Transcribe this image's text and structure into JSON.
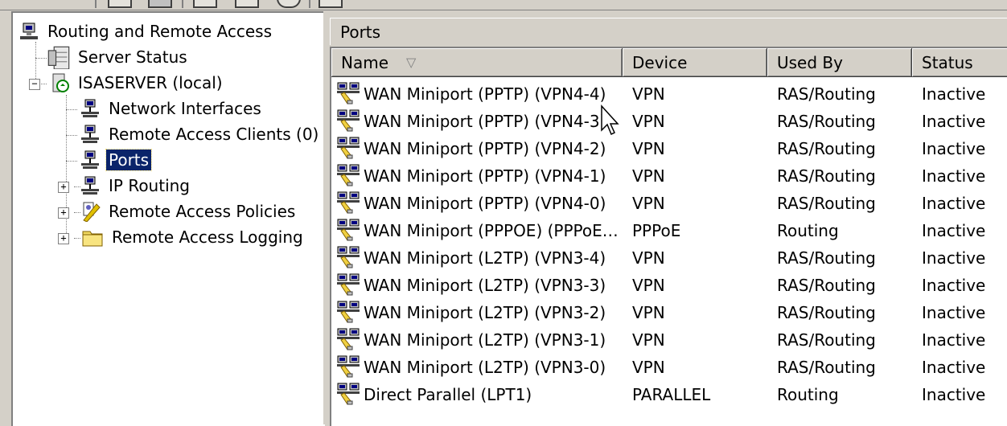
{
  "tree": {
    "root": "Routing and Remote Access",
    "items": [
      {
        "label": "Server Status"
      },
      {
        "label": "ISASERVER (local)"
      },
      {
        "label": "Network Interfaces"
      },
      {
        "label": "Remote Access Clients (0)"
      },
      {
        "label": "Ports",
        "selected": true
      },
      {
        "label": "IP Routing"
      },
      {
        "label": "Remote Access Policies"
      },
      {
        "label": "Remote Access Logging"
      }
    ]
  },
  "pane_title": "Ports",
  "columns": [
    "Name",
    "Device",
    "Used By",
    "Status"
  ],
  "sort_indicator": "▽",
  "rows": [
    {
      "name": "WAN Miniport (PPTP) (VPN4-4)",
      "device": "VPN",
      "used_by": "RAS/Routing",
      "status": "Inactive"
    },
    {
      "name": "WAN Miniport (PPTP) (VPN4-3)",
      "device": "VPN",
      "used_by": "RAS/Routing",
      "status": "Inactive"
    },
    {
      "name": "WAN Miniport (PPTP) (VPN4-2)",
      "device": "VPN",
      "used_by": "RAS/Routing",
      "status": "Inactive"
    },
    {
      "name": "WAN Miniport (PPTP) (VPN4-1)",
      "device": "VPN",
      "used_by": "RAS/Routing",
      "status": "Inactive"
    },
    {
      "name": "WAN Miniport (PPTP) (VPN4-0)",
      "device": "VPN",
      "used_by": "RAS/Routing",
      "status": "Inactive"
    },
    {
      "name": "WAN Miniport (PPPOE) (PPPoE…",
      "device": "PPPoE",
      "used_by": "Routing",
      "status": "Inactive"
    },
    {
      "name": "WAN Miniport (L2TP) (VPN3-4)",
      "device": "VPN",
      "used_by": "RAS/Routing",
      "status": "Inactive"
    },
    {
      "name": "WAN Miniport (L2TP) (VPN3-3)",
      "device": "VPN",
      "used_by": "RAS/Routing",
      "status": "Inactive"
    },
    {
      "name": "WAN Miniport (L2TP) (VPN3-2)",
      "device": "VPN",
      "used_by": "RAS/Routing",
      "status": "Inactive"
    },
    {
      "name": "WAN Miniport (L2TP) (VPN3-1)",
      "device": "VPN",
      "used_by": "RAS/Routing",
      "status": "Inactive"
    },
    {
      "name": "WAN Miniport (L2TP) (VPN3-0)",
      "device": "VPN",
      "used_by": "RAS/Routing",
      "status": "Inactive"
    },
    {
      "name": "Direct Parallel (LPT1)",
      "device": "PARALLEL",
      "used_by": "Routing",
      "status": "Inactive"
    }
  ]
}
